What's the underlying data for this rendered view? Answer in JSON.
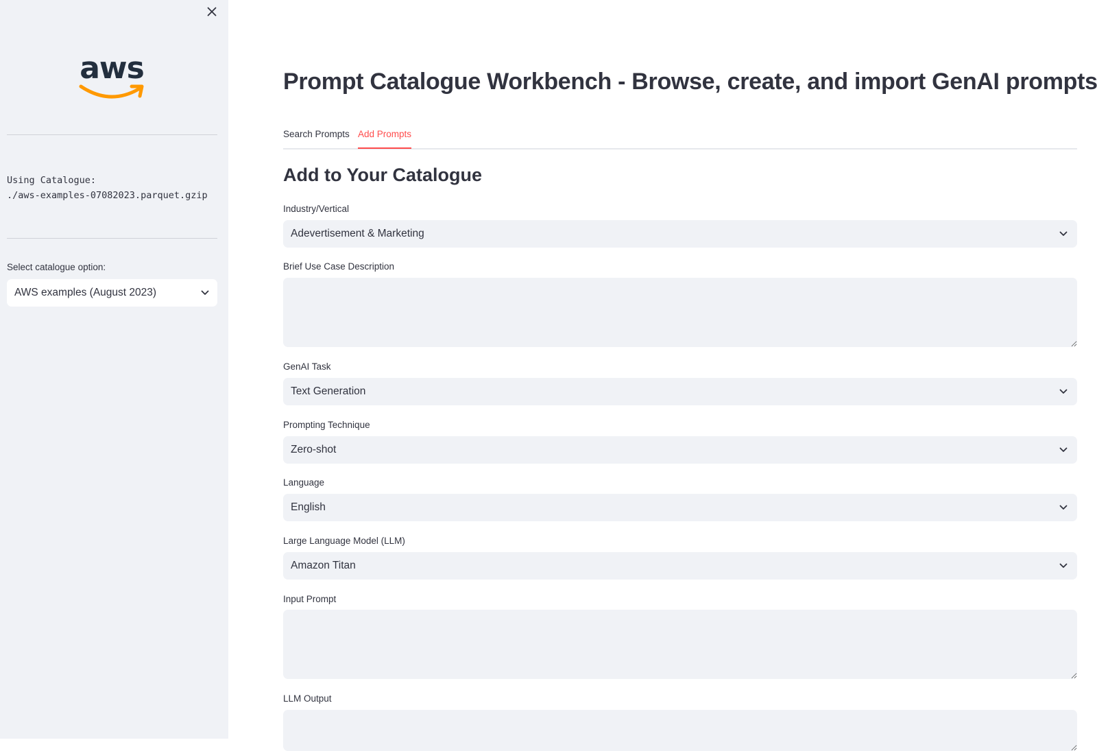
{
  "sidebar": {
    "logo_text": "aws",
    "catalogue_label": "Using Catalogue:",
    "catalogue_path": "./aws-examples-07082023.parquet.gzip",
    "select_label": "Select catalogue option:",
    "select_value": "AWS examples (August 2023)"
  },
  "main": {
    "title": "Prompt Catalogue Workbench - Browse, create, and import GenAI prompts",
    "tabs": [
      {
        "label": "Search Prompts",
        "active": false
      },
      {
        "label": "Add Prompts",
        "active": true
      }
    ],
    "section_title": "Add to Your Catalogue",
    "fields": {
      "industry": {
        "label": "Industry/Vertical",
        "value": "Adevertisement & Marketing"
      },
      "use_case": {
        "label": "Brief Use Case Description",
        "value": ""
      },
      "genai_task": {
        "label": "GenAI Task",
        "value": "Text Generation"
      },
      "prompting_technique": {
        "label": "Prompting Technique",
        "value": "Zero-shot"
      },
      "language": {
        "label": "Language",
        "value": "English"
      },
      "llm": {
        "label": "Large Language Model (LLM)",
        "value": "Amazon Titan"
      },
      "input_prompt": {
        "label": "Input Prompt",
        "value": ""
      },
      "llm_output": {
        "label": "LLM Output",
        "value": ""
      }
    }
  },
  "icons": {
    "close": "close-icon",
    "dropdown": "chevron-down-icon"
  },
  "colors": {
    "sidebar_bg": "#f0f2f6",
    "accent": "#ff4b4b",
    "text": "#31333f",
    "aws_orange": "#ff9900",
    "aws_dark": "#232f3e"
  }
}
